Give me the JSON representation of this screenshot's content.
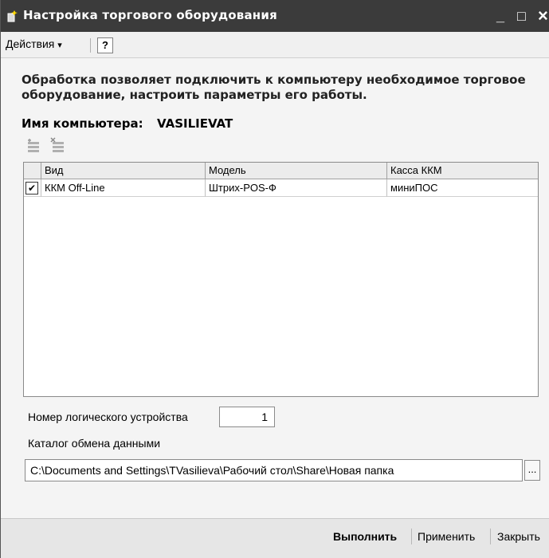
{
  "window": {
    "title": "Настройка торгового оборудования",
    "minimize": "_",
    "maximize": "□",
    "close": "×"
  },
  "menubar": {
    "actions_label": "Действия",
    "actions_arrow": "▾",
    "help_label": "?"
  },
  "description": "Обработка позволяет подключить к компьютеру необходимое торговое оборудование, настроить параметры его работы.",
  "computer": {
    "label": "Имя компьютера:",
    "name": "VASILIEVAT"
  },
  "toolbar": {
    "icons": [
      "add-row-icon",
      "delete-row-icon"
    ]
  },
  "table": {
    "columns": [
      "Вид",
      "Модель",
      "Касса ККМ"
    ],
    "rows": [
      {
        "checked": true,
        "check_mark": "✔",
        "vid": "ККМ Off-Line",
        "model": "Штрих-POS-Ф",
        "kassa": "миниПОС"
      }
    ]
  },
  "logical_device": {
    "label": "Номер логического устройства",
    "value": "1"
  },
  "exchange_dir": {
    "label": "Каталог обмена данными",
    "value": "C:\\Documents and Settings\\TVasilieva\\Рабочий стол\\Share\\Новая папка",
    "browse": "..."
  },
  "buttons": {
    "execute": "Выполнить",
    "apply": "Применить",
    "close": "Закрыть"
  },
  "colors": {
    "titlebar": "#3b3b3b",
    "window_bg": "#f4f4f4",
    "bottom_bar": "#e6e6e6"
  }
}
